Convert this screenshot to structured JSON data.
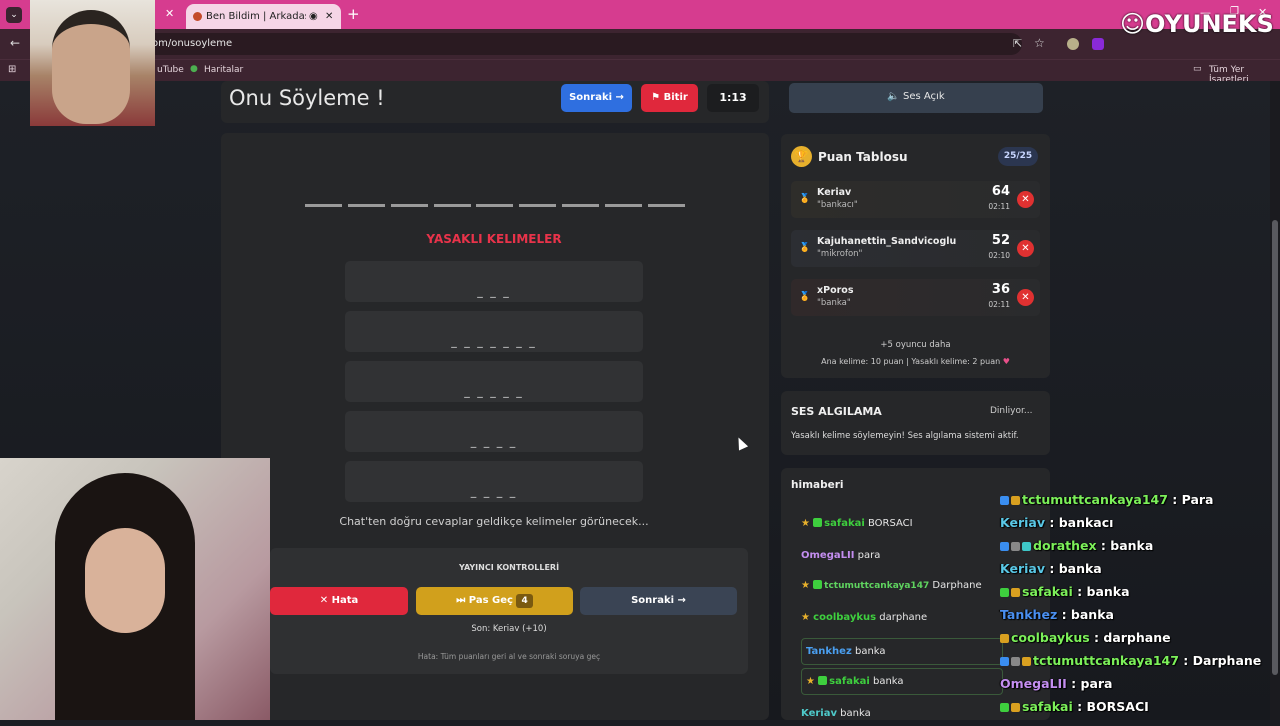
{
  "browser": {
    "tab_title": "Ben Bildim | Arkadaşlarınla",
    "url": "om/onusoyleme",
    "bookmarks": [
      "uTube",
      "Haritalar"
    ],
    "all_bookmarks": "Tüm Yer İşaretleri"
  },
  "brand": {
    "logo_text": "OYUNEKS"
  },
  "game": {
    "title": "Onu Söyleme !",
    "next_label": "Sonraki →",
    "finish_label": "Bitir",
    "timer": "1:13",
    "forbidden_title": "YASAKLI KELIMELER",
    "forbidden_slots": [
      "_ _ _",
      "_ _ _ _ _ _ _",
      "_ _ _ _ _",
      "_ _ _ _",
      "_ _ _ _"
    ],
    "hint": "Chat'ten doğru cevaplar geldikçe kelimeler görünecek...",
    "controls_title": "YAYINCI KONTROLLERİ",
    "wrong_label": "Hata",
    "pass_label": "Pas Geç",
    "pass_count": "4",
    "next2_label": "Sonraki →",
    "last_label": "Son: Keriav (+10)",
    "footnote": "Hata: Tüm puanları geri al ve sonraki soruya geç"
  },
  "sidebar": {
    "sound_label": "Ses Açık",
    "leaderboard_title": "Puan Tablosu",
    "leaderboard_count": "25/25",
    "players": [
      {
        "name": "Keriav",
        "word": "\"bankacı\"",
        "score": "64",
        "time": "02:11",
        "medal_color": "#e0a030"
      },
      {
        "name": "Kajuhanettin_Sandvicoglu",
        "word": "\"mikrofon\"",
        "score": "52",
        "time": "02:10",
        "medal_color": "#b0b8c8"
      },
      {
        "name": "xPoros",
        "word": "\"banka\"",
        "score": "36",
        "time": "02:11",
        "medal_color": "#c8803a"
      }
    ],
    "more_players": "+5 oyuncu daha",
    "scoring_note": "Ana kelime: 10 puan | Yasaklı kelime: 2 puan",
    "voice_title": "SES ALGILAMA",
    "voice_status": "Dinliyor...",
    "voice_note": "Yasaklı kelime söylemeyin! Ses algılama sistemi aktif.",
    "chat_title": "himaberi",
    "chat": [
      {
        "user": "safakai",
        "msg": "BORSACI",
        "color": "#3ecf3e"
      },
      {
        "user": "OmegaLII",
        "msg": "para",
        "color": "#c48ef0"
      },
      {
        "user": "tctumuttcankaya147",
        "msg": "Darphane",
        "color": "#5fd35f"
      },
      {
        "user": "coolbaykus",
        "msg": "darphane",
        "color": "#3ecf3e"
      },
      {
        "user": "Tankhez",
        "msg": "banka",
        "color": "#4a9ff0"
      },
      {
        "user": "safakai",
        "msg": "banka",
        "color": "#3ecf3e"
      },
      {
        "user": "Keriav",
        "msg": "banka",
        "color": "#4ec9c9"
      }
    ]
  },
  "stream_chat": [
    {
      "user": "tctumuttcankaya147",
      "msg": ": Para",
      "color": "#7cf05a"
    },
    {
      "user": "Keriav",
      "msg": ": bankacı",
      "color": "#5ac8e6"
    },
    {
      "user": "dorathex",
      "msg": ": banka",
      "color": "#7cf05a"
    },
    {
      "user": "Keriav",
      "msg": ": banka",
      "color": "#5ac8e6"
    },
    {
      "user": "safakai",
      "msg": ": banka",
      "color": "#7cf05a"
    },
    {
      "user": "Tankhez",
      "msg": ": banka",
      "color": "#4a8ff0"
    },
    {
      "user": "coolbaykus",
      "msg": ": darphane",
      "color": "#7cf05a"
    },
    {
      "user": "tctumuttcankaya147",
      "msg": ": Darphane",
      "color": "#7cf05a"
    },
    {
      "user": "OmegaLII",
      "msg": ": para",
      "color": "#c48ef0"
    },
    {
      "user": "safakai",
      "msg": ": BORSACI",
      "color": "#7cf05a"
    }
  ],
  "colors": {
    "accent_pink": "#d63c8f",
    "blue_button": "#2f6fe0",
    "red_button": "#e0283c",
    "gold_button": "#d1a01c"
  }
}
